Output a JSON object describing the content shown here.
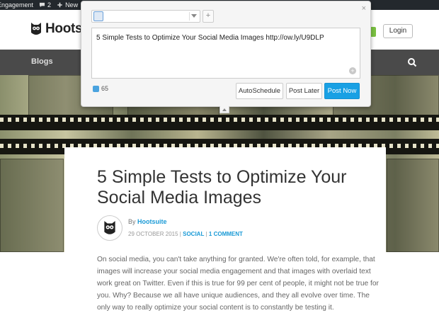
{
  "adminbar": {
    "site_label": "Engagement",
    "comments_count": "2",
    "new_label": "New"
  },
  "header": {
    "logo_text": "Hootsuite",
    "login_label": "Login"
  },
  "nav": {
    "blogs_label": "Blogs"
  },
  "popup": {
    "compose_text": "5 Simple Tests to Optimize Your Social Media Images http://ow.ly/U9DLP",
    "add_label": "+",
    "close_label": "×",
    "char_count": "65",
    "autoschedule_label": "AutoSchedule",
    "post_later_label": "Post Later",
    "post_now_label": "Post Now"
  },
  "article": {
    "title": "5 Simple Tests to Optimize Your Social Media Images",
    "by_prefix": "By",
    "author": "Hootsuite",
    "date": "29 OCTOBER 2015",
    "category": "SOCIAL",
    "comments": "1 COMMENT",
    "separator": "|",
    "body": "On social media, you can't take anything for granted. We're often told, for example, that images will increase your social media engagement and that images with overlaid text work great on Twitter. Even if this is true for 99 per cent of people, it might not be true for you. Why? Because we all have unique audiences, and they all evolve over time. The only way to really optimize your social content is to constantly be testing it."
  },
  "colors": {
    "accent": "#18a0e4",
    "link": "#1a9ad6",
    "nav_bg": "#4a4a4a",
    "adminbar_bg": "#23282d"
  },
  "icons": [
    "comment-icon",
    "plus-icon",
    "edit-icon",
    "owl-logo-icon",
    "search-icon",
    "twitter-icon",
    "attach-icon",
    "chevron-up-icon"
  ]
}
